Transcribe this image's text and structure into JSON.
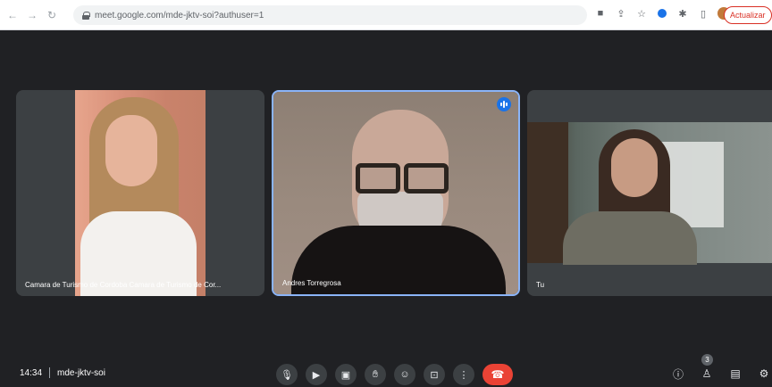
{
  "browser": {
    "url": "meet.google.com/mde-jktv-soi?authuser=1",
    "update_label": "Actualizar"
  },
  "tiles": [
    {
      "name": "Camara de Turismo de Cordoba Camara de Turismo de Cor..."
    },
    {
      "name": "Andres Torregrosa",
      "speaking": true
    },
    {
      "name": "Tu"
    }
  ],
  "bottom_bar": {
    "time": "14:34",
    "meeting_code": "mde-jktv-soi",
    "participants_count": "3"
  },
  "colors": {
    "background": "#202124",
    "tile": "#3c4043",
    "active_border": "#8ab4f8",
    "end_call": "#ea4335",
    "accent": "#1a73e8"
  }
}
